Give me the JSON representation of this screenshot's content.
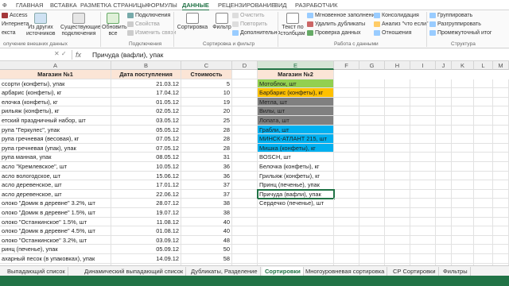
{
  "ribbon_tabs": [
    "Ф",
    "ГЛАВНАЯ",
    "ВСТАВКА",
    "РАЗМЕТКА СТРАНИЦЫ",
    "ФОРМУЛЫ",
    "ДАННЫЕ",
    "РЕЦЕНЗИРОВАНИЕ",
    "ВИД",
    "РАЗРАБОТЧИК"
  ],
  "active_tab": "ДАННЫЕ",
  "ribbon": {
    "access": "Access",
    "internet": "Интернета",
    "text": "екста",
    "from_other": "Из других",
    "sources": "источников",
    "existing": "Существующие",
    "connections": "подключения",
    "refresh": "Обновить",
    "all": "все",
    "conn_list": [
      "Подключения",
      "Свойства",
      "Изменить связи"
    ],
    "sort": "Сортировка",
    "filter": "Фильтр",
    "filter_opts": [
      "Очистить",
      "Повторить",
      "Дополнительно"
    ],
    "text_cols_1": "Текст по",
    "text_cols_2": "столбцам",
    "tools": [
      "Мгновенное заполнение",
      "Удалить дубликаты",
      "Проверка данных"
    ],
    "tools2": [
      "Консолидация",
      "Анализ \"что если\"",
      "Отношения"
    ],
    "structure": [
      "Группировать",
      "Разгруппировать",
      "Промежуточный итог"
    ],
    "group_labels": [
      "олучение внешних данных",
      "Подключения",
      "Сортировка и фильтр",
      "Работа с данными",
      "Структура"
    ]
  },
  "formula_bar": {
    "fx": "fx",
    "value": "Причуда (вафли), упак"
  },
  "columns": [
    "A",
    "B",
    "C",
    "D",
    "E",
    "F",
    "G",
    "H",
    "I",
    "J",
    "K",
    "L",
    "M"
  ],
  "selected_column": "E",
  "headers": {
    "a": "Магазин №1",
    "b": "Дата поступления",
    "c": "Стоимость",
    "e": "Магазин №2"
  },
  "rows": [
    {
      "a": "ссорти (конфеты), упак",
      "b": "21.03.12",
      "c": "5",
      "e": "Мотоблок, шт",
      "ecolor": "#92d050"
    },
    {
      "a": "арбарис (конфеты), кг",
      "b": "17.04.12",
      "c": "10",
      "e": "Барбарис (конфеты), кг",
      "ecolor": "#ffc000"
    },
    {
      "a": "елочка (конфеты), кг",
      "b": "01.05.12",
      "c": "19",
      "e": "Метла, шт",
      "ecolor": "#808080"
    },
    {
      "a": "рильяж (конфеты), кг",
      "b": "02.05.12",
      "c": "20",
      "e": "Вилы, шт",
      "ecolor": "#808080"
    },
    {
      "a": "етский праздничный набор, шт",
      "b": "03.05.12",
      "c": "25",
      "e": "Лопата, шт",
      "ecolor": "#808080"
    },
    {
      "a": "рупа \"Геркулес\", упак",
      "b": "05.05.12",
      "c": "28",
      "e": "Грабли, шт",
      "ecolor": "#00b0f0"
    },
    {
      "a": "рупа гречневая (весовая), кг",
      "b": "07.05.12",
      "c": "28",
      "e": "МИНСК-АТЛАНТ 215, шт",
      "ecolor": "#00b0f0"
    },
    {
      "a": "рупа гречневая (упак), упак",
      "b": "07.05.12",
      "c": "28",
      "e": "Мишка (конфеты), кг",
      "ecolor": "#00b0f0"
    },
    {
      "a": "рупа манная, упак",
      "b": "08.05.12",
      "c": "31",
      "e": "BOSCH, шт",
      "ecolor": ""
    },
    {
      "a": "асло \"Кремлевское\", шт",
      "b": "10.05.12",
      "c": "36",
      "e": "Белочка (конфеты), кг",
      "ecolor": ""
    },
    {
      "a": "асло вологодское, шт",
      "b": "15.06.12",
      "c": "36",
      "e": "Грильяж (конфеты), кг",
      "ecolor": ""
    },
    {
      "a": "асло деревенское, шт",
      "b": "17.01.12",
      "c": "37",
      "e": "Принц (печенье), упак",
      "ecolor": ""
    },
    {
      "a": "асло деревенское, шт",
      "b": "22.06.12",
      "c": "37",
      "e": "Причуда (вафли), упак",
      "ecolor": "",
      "selected": true
    },
    {
      "a": "олоко \"Домик в деревне\" 3.2%, шт",
      "b": "28.07.12",
      "c": "38",
      "e": "Сердечко (печенье), шт",
      "ecolor": ""
    },
    {
      "a": "олоко \"Домик в деревне\" 1.5%, шт",
      "b": "19.07.12",
      "c": "38",
      "e": "",
      "ecolor": ""
    },
    {
      "a": "олоко \"Останкинское\" 1.5%, шт",
      "b": "11.08.12",
      "c": "40",
      "e": "",
      "ecolor": ""
    },
    {
      "a": "олоко \"Домик в деревне\" 4.5%, шт",
      "b": "01.08.12",
      "c": "40",
      "e": "",
      "ecolor": ""
    },
    {
      "a": "олоко \"Останкинское\" 3.2%, шт",
      "b": "03.09.12",
      "c": "48",
      "e": "",
      "ecolor": ""
    },
    {
      "a": "ринц (печенье), упак",
      "b": "05.09.12",
      "c": "50",
      "e": "",
      "ecolor": ""
    },
    {
      "a": "ахарный песок (в упаковках), упак",
      "b": "14.09.12",
      "c": "58",
      "e": "",
      "ecolor": ""
    },
    {
      "a": "ахарный песок (весовой), кг",
      "b": "20.09.12",
      "c": "59",
      "e": "",
      "ecolor": ""
    },
    {
      "a": "ердечко (печенье), шт",
      "b": "23.09.12",
      "c": "540",
      "e": "",
      "ecolor": ""
    }
  ],
  "sheet_tabs": [
    "Выпадающий список",
    "Динамический выпадающий список",
    "Дубликаты, Разделение",
    "Сортировки",
    "Многоуровневая сортировка",
    "СР Сортировки",
    "Фильтры"
  ],
  "active_sheet": "Сортировки",
  "colors": {
    "accent": "#217346",
    "header_fill": "#fbe5d6"
  }
}
